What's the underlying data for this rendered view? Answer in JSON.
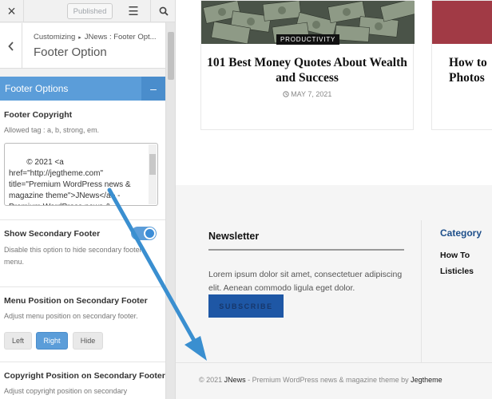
{
  "topbar": {
    "close_icon": "×",
    "publish_label": "Published",
    "menu_icon": "☰"
  },
  "section": {
    "breadcrumb_parent": "Customizing",
    "breadcrumb_sep": "▸",
    "breadcrumb_child": "JNews : Footer Opt...",
    "title": "Footer Option",
    "back_icon": "‹"
  },
  "group": {
    "title": "Footer Options",
    "collapse_icon": "–"
  },
  "controls": {
    "copyright": {
      "title": "Footer Copyright",
      "desc": "Allowed tag : a, b, strong, em.",
      "value": "© 2021 <a href=\"http://jegtheme.com\" title=\"Premium WordPress news & magazine theme\">JNews</a> - Premium WordPress news &"
    },
    "secondary_footer": {
      "title": "Show Secondary Footer",
      "desc": "Disable this option to hide secondary footer menu.",
      "enabled": true
    },
    "menu_position": {
      "title": "Menu Position on Secondary Footer",
      "desc": "Adjust menu position on secondary footer.",
      "options": [
        "Left",
        "Right",
        "Hide"
      ],
      "selected": "Right"
    },
    "copyright_position": {
      "title": "Copyright Position on Secondary Footer",
      "desc": "Adjust copyright position on secondary"
    }
  },
  "preview": {
    "card_main": {
      "category": "PRODUCTIVITY",
      "title": "101 Best Money Quotes About Wealth and Success",
      "date": "MAY 7, 2021"
    },
    "card_partial": {
      "title": "How to Photos"
    },
    "newsletter": {
      "title": "Newsletter",
      "text": "Lorem ipsum dolor sit amet, consectetuer adipiscing elit. Aenean commodo ligula eget dolor.",
      "button": "SUBSCRIBE"
    },
    "category": {
      "title": "Category",
      "items": [
        "How To",
        "Listicles"
      ]
    },
    "copyright": {
      "prefix": "© 2021 ",
      "brand": "JNews",
      "middle": " - Premium WordPress news & magazine theme by ",
      "author": "Jegtheme"
    }
  },
  "colors": {
    "accent": "#5b9dd9",
    "subscribe": "#1e57a5",
    "arrow": "#3a8fd0"
  }
}
